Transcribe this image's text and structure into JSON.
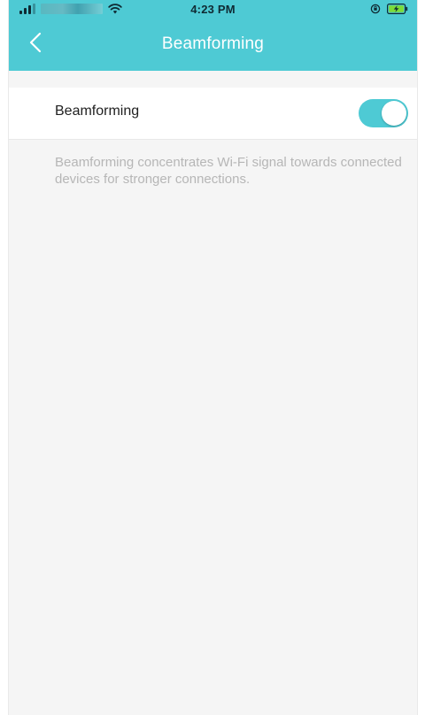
{
  "status_bar": {
    "time": "4:23 PM",
    "signal_icon": "cellular-signal-icon",
    "wifi_icon": "wifi-icon",
    "orientation_lock_icon": "orientation-lock-icon",
    "battery_icon": "battery-charging-icon"
  },
  "nav": {
    "back_icon": "chevron-left-icon",
    "title": "Beamforming"
  },
  "setting": {
    "label": "Beamforming",
    "enabled": true
  },
  "description": "Beamforming concentrates Wi-Fi signal towards connected devices for stronger connections.",
  "colors": {
    "accent": "#4ecad4",
    "background": "#f5f5f5",
    "row_background": "#ffffff",
    "label_text": "#1f1f1f",
    "description_text": "#b6b6b6"
  }
}
